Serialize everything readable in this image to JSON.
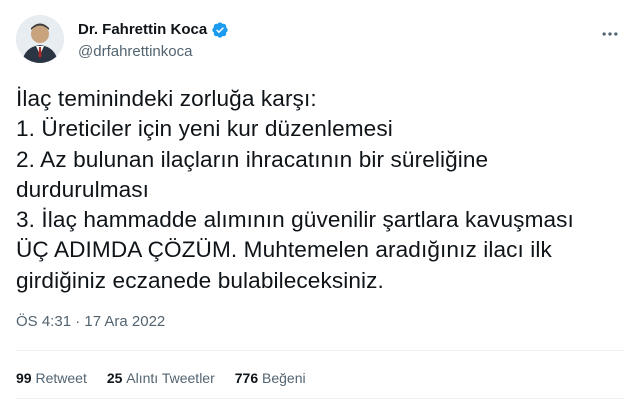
{
  "tweet": {
    "author": {
      "display_name": "Dr. Fahrettin Koca",
      "handle": "@drfahrettinkoca",
      "verified_icon": "verified-badge-icon",
      "verified_color": "#1d9bf0"
    },
    "more_icon": "more-horizontal-icon",
    "body_lines": [
      "İlaç temininde​ki zorluğa karşı:",
      "1. Üreticiler için yeni kur düzenlemesi",
      "2. Az bulunan ilaçların ihracatının bir süreliğine",
      "durdurulması",
      "3. İlaç hammadde alımının güvenilir şartlara kavuşması",
      "ÜÇ ADIMDA ÇÖZÜM. Muhtemelen aradığınız ilacı ilk",
      "girdiğiniz eczanede bulabileceksiniz."
    ],
    "timestamp": "ÖS 4:31 · 17 Ara 2022",
    "stats": {
      "retweets_count": "99",
      "retweets_label": "Retweet",
      "quotes_count": "25",
      "quotes_label": "Alıntı Tweetler",
      "likes_count": "776",
      "likes_label": "Beğeni"
    }
  }
}
